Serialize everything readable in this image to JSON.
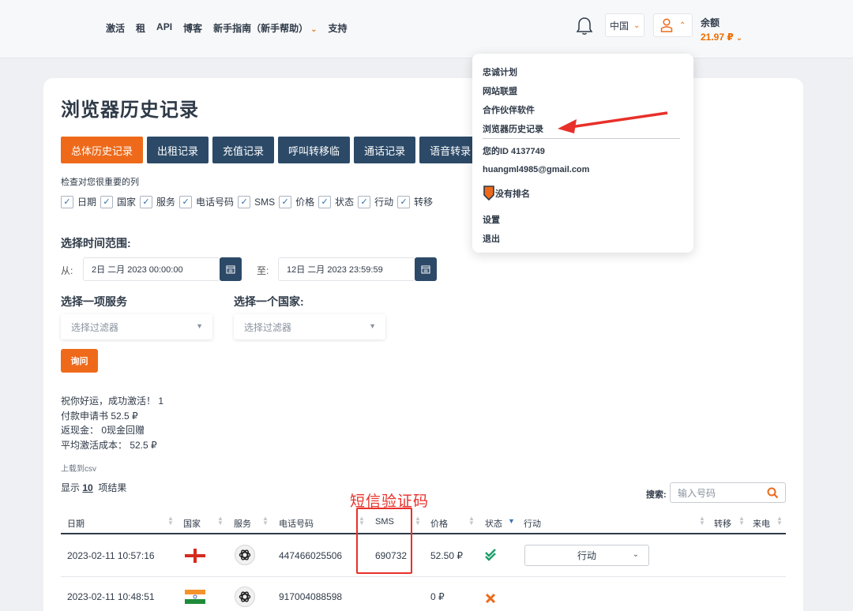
{
  "nav": {
    "items": [
      "激活",
      "租",
      "API",
      "博客",
      "新手指南（新手帮助）",
      "支持"
    ],
    "language": "中国",
    "balance_label": "余额",
    "balance_value": "21.97 ₽"
  },
  "dropdown": {
    "items": [
      "忠诚计划",
      "网站联盟",
      "合作伙伴软件",
      "浏览器历史记录"
    ],
    "user_id": "您的ID 4137749",
    "email": "huangml4985@gmail.com",
    "rank": "没有排名",
    "settings": "设置",
    "logout": "退出"
  },
  "page": {
    "title": "浏览器历史记录",
    "tabs": [
      "总体历史记录",
      "出租记录",
      "充值记录",
      "呼叫转移临",
      "通话记录",
      "语音转录"
    ],
    "check_title": "检查对您很重要的列",
    "columns_check": [
      "日期",
      "国家",
      "服务",
      "电话号码",
      "SMS",
      "价格",
      "状态",
      "行动",
      "转移"
    ],
    "range_title": "选择时间范围:",
    "from_label": "从:",
    "from_value": "2日 二月 2023 00:00:00",
    "to_label": "至:",
    "to_value": "12日 二月 2023 23:59:59",
    "service_title": "选择一项服务",
    "country_title": "选择一个国家:",
    "filter_placeholder": "选择过滤器",
    "query_button": "询问",
    "stats": [
      "祝你好运，成功激活！ 1",
      "付款申请书 52.5 ₽",
      "返现金： 0现金回赠",
      "平均激活成本： 52.5 ₽"
    ],
    "csv": "上载到csv",
    "show_prefix": "显示",
    "show_count": "10",
    "show_suffix": "项结果",
    "search_label": "搜索:",
    "search_placeholder": "输入号码"
  },
  "table": {
    "headers": [
      "日期",
      "国家",
      "服务",
      "电话号码",
      "SMS",
      "价格",
      "状态",
      "行动",
      "转移",
      "来电"
    ],
    "rows": [
      {
        "date": "2023-02-11 10:57:16",
        "phone": "447466025506",
        "sms": "690732",
        "price": "52.50 ₽",
        "action": "行动"
      },
      {
        "date": "2023-02-11 10:48:51",
        "phone": "917004088598",
        "sms": "",
        "price": "0 ₽",
        "action": ""
      }
    ]
  },
  "annotation": {
    "text": "短信验证码"
  },
  "colors": {
    "accent": "#ee6a1a",
    "tab_dark": "#2c4a68",
    "annotation_red": "#e8302a"
  }
}
